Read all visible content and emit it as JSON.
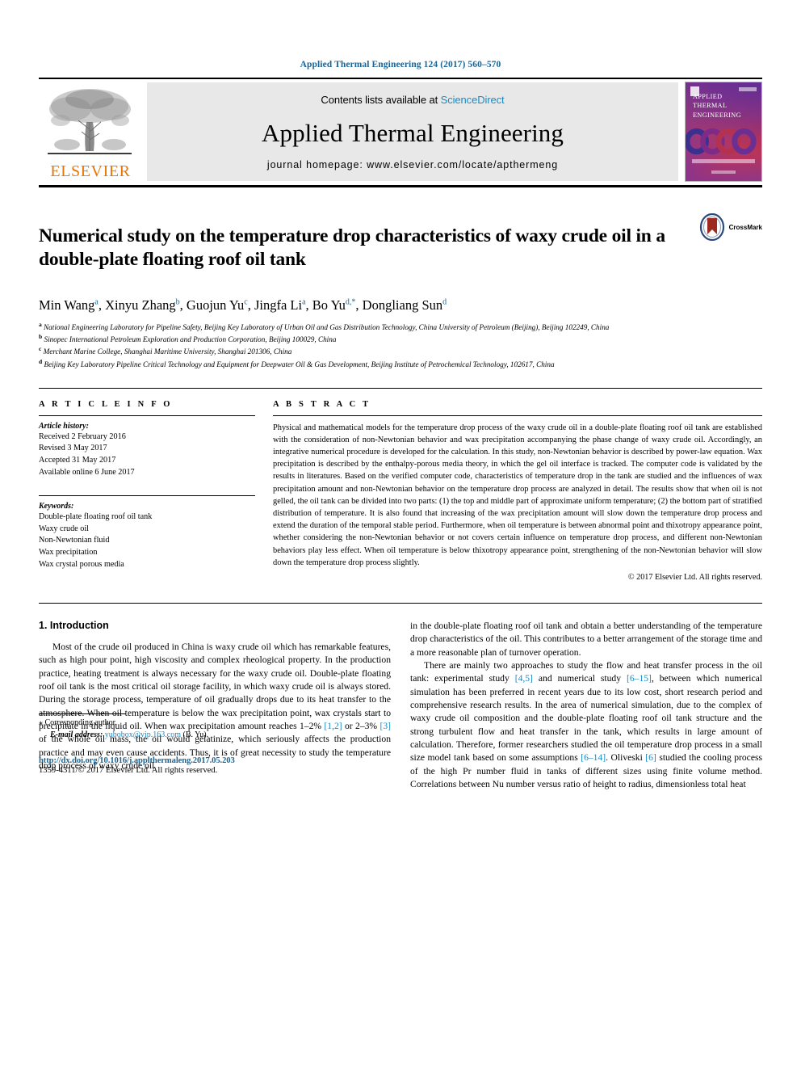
{
  "running_head": "Applied Thermal Engineering 124 (2017) 560–570",
  "masthead": {
    "contents_prefix": "Contents lists available at",
    "sciencedirect": "ScienceDirect",
    "journal_title": "Applied Thermal Engineering",
    "homepage": "journal homepage: www.elsevier.com/locate/apthermeng",
    "publisher": "ELSEVIER",
    "cover_title": "APPLIED THERMAL ENGINEERING"
  },
  "article": {
    "title": "Numerical study on the temperature drop characteristics of waxy crude oil in a double-plate floating roof oil tank",
    "crossmark_label": "CrossMark",
    "authors": [
      {
        "name": "Min Wang",
        "sup": "a"
      },
      {
        "name": "Xinyu Zhang",
        "sup": "b"
      },
      {
        "name": "Guojun Yu",
        "sup": "c"
      },
      {
        "name": "Jingfa Li",
        "sup": "a"
      },
      {
        "name": "Bo Yu",
        "sup": "d,*"
      },
      {
        "name": "Dongliang Sun",
        "sup": "d"
      }
    ],
    "affiliations": [
      {
        "label": "a",
        "text": "National Engineering Laboratory for Pipeline Safety, Beijing Key Laboratory of Urban Oil and Gas Distribution Technology, China University of Petroleum (Beijing), Beijing 102249, China"
      },
      {
        "label": "b",
        "text": "Sinopec International Petroleum Exploration and Production Corporation, Beijing 100029, China"
      },
      {
        "label": "c",
        "text": "Merchant Marine College, Shanghai Maritime University, Shanghai 201306, China"
      },
      {
        "label": "d",
        "text": "Beijing Key Laboratory Pipeline Critical Technology and Equipment for Deepwater Oil & Gas Development, Beijing Institute of Petrochemical Technology, 102617, China"
      }
    ]
  },
  "article_info": {
    "heading": "A R T I C L E    I N F O",
    "history_label": "Article history:",
    "history": [
      "Received 2 February 2016",
      "Revised 3 May 2017",
      "Accepted 31 May 2017",
      "Available online 6 June 2017"
    ],
    "keywords_label": "Keywords:",
    "keywords": [
      "Double-plate floating roof oil tank",
      "Waxy crude oil",
      "Non-Newtonian fluid",
      "Wax precipitation",
      "Wax crystal porous media"
    ]
  },
  "abstract": {
    "heading": "A B S T R A C T",
    "text": "Physical and mathematical models for the temperature drop process of the waxy crude oil in a double-plate floating roof oil tank are established with the consideration of non-Newtonian behavior and wax precipitation accompanying the phase change of waxy crude oil. Accordingly, an integrative numerical procedure is developed for the calculation. In this study, non-Newtonian behavior is described by power-law equation. Wax precipitation is described by the enthalpy-porous media theory, in which the gel oil interface is tracked. The computer code is validated by the results in literatures. Based on the verified computer code, characteristics of temperature drop in the tank are studied and the influences of wax precipitation amount and non-Newtonian behavior on the temperature drop process are analyzed in detail. The results show that when oil is not gelled, the oil tank can be divided into two parts: (1) the top and middle part of approximate uniform temperature; (2) the bottom part of stratified distribution of temperature. It is also found that increasing of the wax precipitation amount will slow down the temperature drop process and extend the duration of the temporal stable period. Furthermore, when oil temperature is between abnormal point and thixotropy appearance point, whether considering the non-Newtonian behavior or not covers certain influence on temperature drop process, and different non-Newtonian behaviors play less effect. When oil temperature is below thixotropy appearance point, strengthening of the non-Newtonian behavior will slow down the temperature drop process slightly.",
    "copyright": "© 2017 Elsevier Ltd. All rights reserved."
  },
  "body": {
    "section_heading": "1. Introduction",
    "left_paragraphs": [
      "Most of the crude oil produced in China is waxy crude oil which has remarkable features, such as high pour point, high viscosity and complex rheological property. In the production practice, heating treatment is always necessary for the waxy crude oil. Double-plate floating roof oil tank is the most critical oil storage facility, in which waxy crude oil is always stored. During the storage process, temperature of oil gradually drops due to its heat transfer to the atmosphere. When oil temperature is below the wax precipitation point, wax crystals start to precipitate in the liquid oil. When wax precipitation amount reaches 1–2% [1,2] or 2–3% [3] of the whole oil mass, the oil would gelatinize, which seriously affects the production practice and may even cause accidents. Thus, it is of great necessity to study the temperature drop process of waxy crude oil"
    ],
    "right_paragraphs": [
      "in the double-plate floating roof oil tank and obtain a better understanding of the temperature drop characteristics of the oil. This contributes to a better arrangement of the storage time and a more reasonable plan of turnover operation.",
      "There are mainly two approaches to study the flow and heat transfer process in the oil tank: experimental study [4,5] and numerical study [6–15], between which numerical simulation has been preferred in recent years due to its low cost, short research period and comprehensive research results. In the area of numerical simulation, due to the complex of waxy crude oil composition and the double-plate floating roof oil tank structure and the strong turbulent flow and heat transfer in the tank, which results in large amount of calculation. Therefore, former researchers studied the oil temperature drop process in a small size model tank based on some assumptions [6–14]. Oliveski [6] studied the cooling process of the high Pr number fluid in tanks of different sizes using finite volume method. Correlations between Nu number versus ratio of height to radius, dimensionless total heat"
    ]
  },
  "footnote": {
    "corresponding_marker": "⁎",
    "corresponding_text": "Corresponding author.",
    "email_label": "E-mail address:",
    "email": "yubobox@vip.163.com",
    "email_suffix": "(B. Yu)."
  },
  "doi_block": {
    "doi": "http://dx.doi.org/10.1016/j.applthermaleng.2017.05.203",
    "issn": "1359-4311/© 2017 Elsevier Ltd. All rights reserved."
  },
  "colors": {
    "link_blue": "#1a8ac4",
    "header_blue": "#1a6496",
    "elsevier_orange": "#ec7404",
    "masthead_gray": "#e8e8e8"
  }
}
